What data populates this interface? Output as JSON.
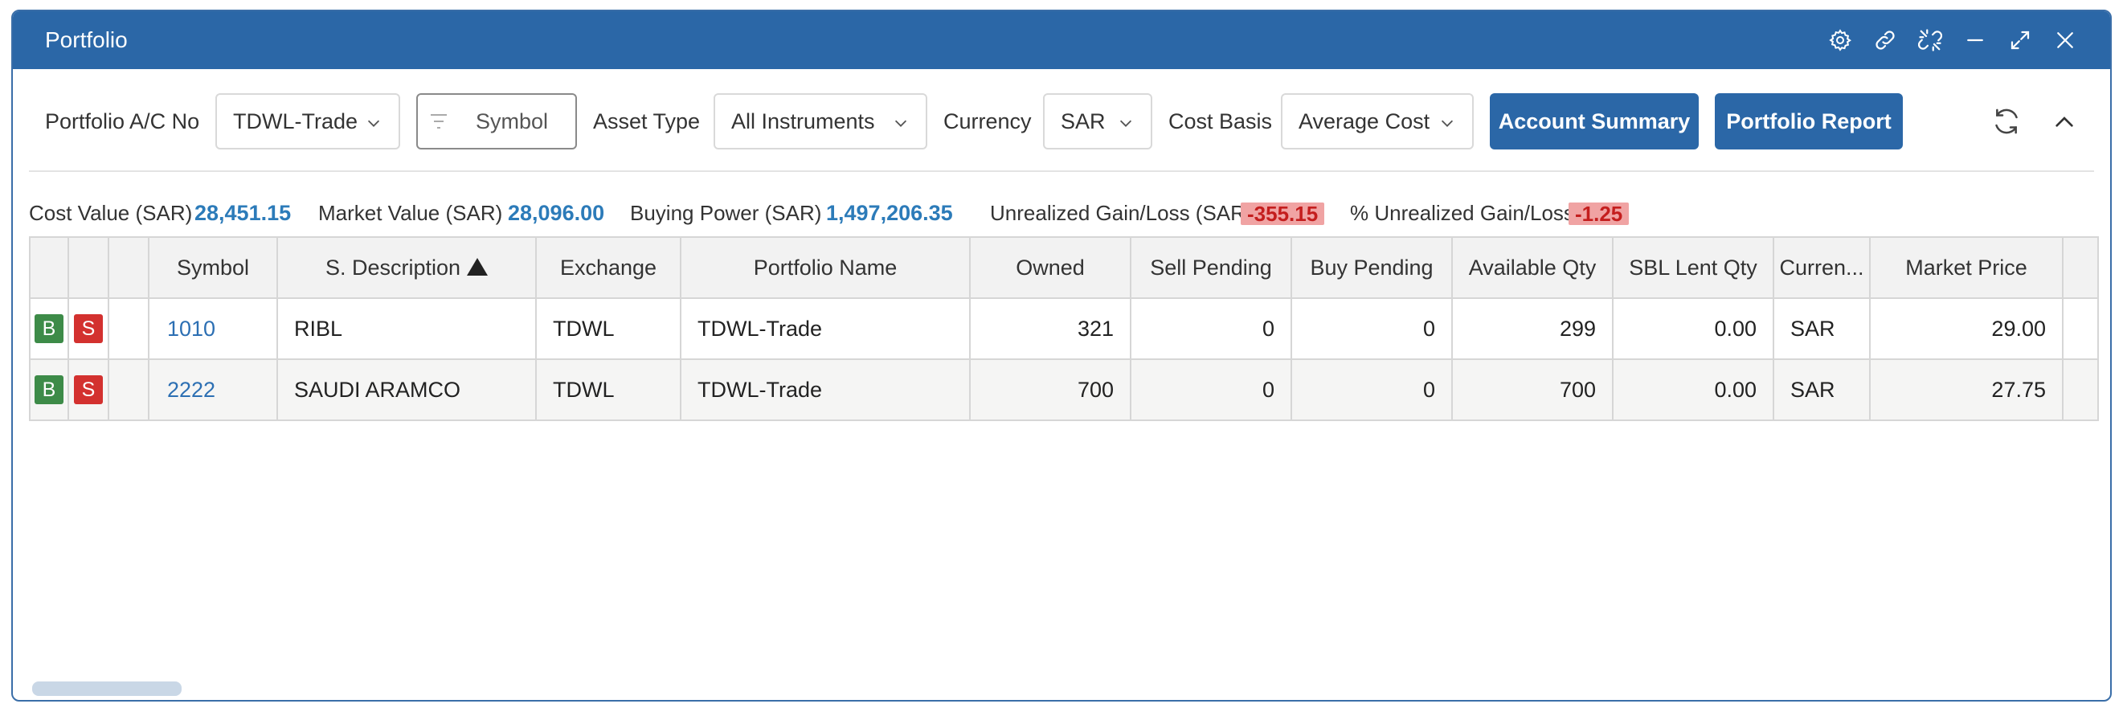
{
  "window": {
    "title": "Portfolio",
    "title_icons": [
      "gear-icon",
      "link-icon",
      "unlink-icon",
      "minimize-icon",
      "expand-icon",
      "close-icon"
    ]
  },
  "toolbar": {
    "portfolio_label": "Portfolio A/C No",
    "portfolio_value": "TDWL-Trade",
    "symbol_placeholder": "Symbol",
    "asset_type_label": "Asset Type",
    "asset_type_value": "All Instruments",
    "currency_label": "Currency",
    "currency_value": "SAR",
    "cost_basis_label": "Cost Basis",
    "cost_basis_value": "Average Cost",
    "account_summary_label": "Account Summary",
    "portfolio_report_label": "Portfolio Report",
    "refresh_icon": "refresh-icon",
    "collapse_icon": "chevron-up-icon"
  },
  "summary": {
    "cost_value_label": "Cost Value (SAR)",
    "cost_value": "28,451.15",
    "market_value_label": "Market Value (SAR)",
    "market_value": "28,096.00",
    "buying_power_label": "Buying Power (SAR)",
    "buying_power": "1,497,206.35",
    "unrealized_label": "Unrealized Gain/Loss (SAR)",
    "unrealized_value": "-355.15",
    "pct_unrealized_label": "% Unrealized Gain/Loss",
    "pct_unrealized_value": "-1.25"
  },
  "table": {
    "columns": [
      "",
      "",
      "",
      "Symbol",
      "S. Description",
      "Exchange",
      "Portfolio Name",
      "Owned",
      "Sell Pending",
      "Buy Pending",
      "Available Qty",
      "SBL Lent Qty",
      "Curren...",
      "Market Price",
      ""
    ],
    "buy_label": "B",
    "sell_label": "S",
    "rows": [
      {
        "symbol": "1010",
        "description": "RIBL",
        "exchange": "TDWL",
        "portfolio": "TDWL-Trade",
        "owned": "321",
        "sell_pending": "0",
        "buy_pending": "0",
        "available": "299",
        "sbl_lent": "0.00",
        "currency": "SAR",
        "market_price": "29.00"
      },
      {
        "symbol": "2222",
        "description": "SAUDI ARAMCO",
        "exchange": "TDWL",
        "portfolio": "TDWL-Trade",
        "owned": "700",
        "sell_pending": "0",
        "buy_pending": "0",
        "available": "700",
        "sbl_lent": "0.00",
        "currency": "SAR",
        "market_price": "27.75"
      }
    ]
  },
  "colors": {
    "titlebar": "#2b67a7",
    "primary_button": "#2b67a7",
    "value_blue": "#2c7bb9",
    "loss_bg": "#f0a3a3",
    "loss_text": "#c41e1e",
    "buy_badge": "#3d8b48",
    "sell_badge": "#d3312f"
  }
}
